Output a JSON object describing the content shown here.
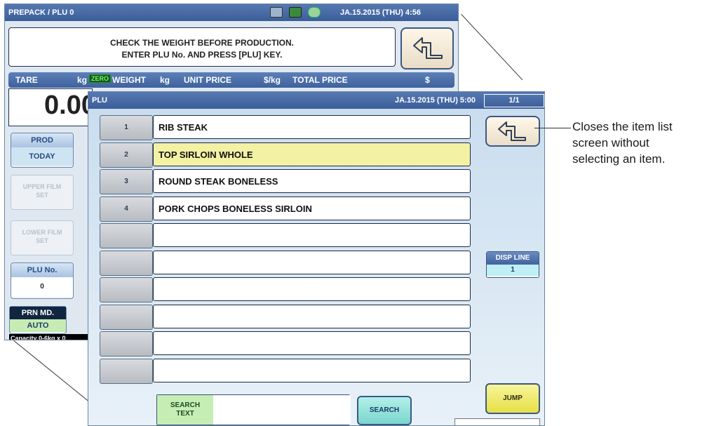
{
  "back_screen": {
    "title": "PREPACK / PLU 0",
    "datetime": "JA.15.2015 (THU)   4:56",
    "message_line1": "CHECK THE WEIGHT BEFORE PRODUCTION.",
    "message_line2": "ENTER PLU No. AND PRESS [PLU] KEY.",
    "header": {
      "tare": "TARE",
      "kg1": "kg",
      "zero": "ZERO",
      "weight": "WEIGHT",
      "kg2": "kg",
      "unit_price": "UNIT PRICE",
      "per_kg": "$/kg",
      "total_price": "TOTAL PRICE",
      "dollar": "$"
    },
    "tare_value": "0.00",
    "prod": {
      "label": "PROD",
      "value": "TODAY"
    },
    "upper_film": {
      "line1": "UPPER FILM",
      "line2": "SET"
    },
    "lower_film": {
      "line1": "LOWER FILM",
      "line2": "SET"
    },
    "plu_no": {
      "label": "PLU No.",
      "value": "0"
    },
    "prn_md": {
      "label": "PRN MD.",
      "value": "AUTO"
    },
    "capacity": "Capacity 0-6kg x 0"
  },
  "item_list_screen": {
    "title": "PLU",
    "datetime": "JA.15.2015 (THU)   5:00",
    "page": "1/1",
    "items": [
      {
        "num": "1",
        "name": "RIB STEAK",
        "selected": false
      },
      {
        "num": "2",
        "name": "TOP SIRLOIN WHOLE",
        "selected": true
      },
      {
        "num": "3",
        "name": "ROUND STEAK BONELESS",
        "selected": false
      },
      {
        "num": "4",
        "name": "PORK CHOPS BONELESS SIRLOIN",
        "selected": false
      },
      {
        "num": "",
        "name": "",
        "selected": false
      },
      {
        "num": "",
        "name": "",
        "selected": false
      },
      {
        "num": "",
        "name": "",
        "selected": false
      },
      {
        "num": "",
        "name": "",
        "selected": false
      },
      {
        "num": "",
        "name": "",
        "selected": false
      },
      {
        "num": "",
        "name": "",
        "selected": false
      }
    ],
    "disp_line": {
      "label": "DISP LINE",
      "value": "1"
    },
    "search_text": {
      "line1": "SEARCH",
      "line2": "TEXT",
      "value": ""
    },
    "search_button": "SEARCH",
    "jump_button": "JUMP"
  },
  "callout": {
    "line1": "Closes the item list",
    "line2": "screen without",
    "line3": "selecting an item."
  },
  "icons": [
    "return-arrow-icon",
    "monitor-icon",
    "battery-icon",
    "network-icon"
  ]
}
